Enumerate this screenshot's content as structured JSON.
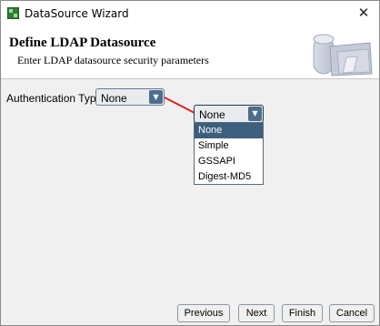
{
  "window": {
    "title": "DataSource Wizard",
    "close_glyph": "✕"
  },
  "header": {
    "title": "Define LDAP Datasource",
    "subtitle": "Enter LDAP datasource security parameters",
    "graphic_icon": "database-folder-icon"
  },
  "form": {
    "auth_label": "Authentication Type:",
    "auth_value": "None",
    "dropdown_value": "None",
    "arrow_glyph": "▼"
  },
  "dropdown": {
    "options": [
      "None",
      "Simple",
      "GSSAPI",
      "Digest-MD5"
    ],
    "selected_index": 0
  },
  "buttons": {
    "previous": "Previous",
    "next": "Next",
    "finish": "Finish",
    "cancel": "Cancel"
  },
  "colors": {
    "connector_line": "#e02020",
    "selected_bg": "#3d5f7e",
    "arrow_bg": "#4f6d8c"
  }
}
